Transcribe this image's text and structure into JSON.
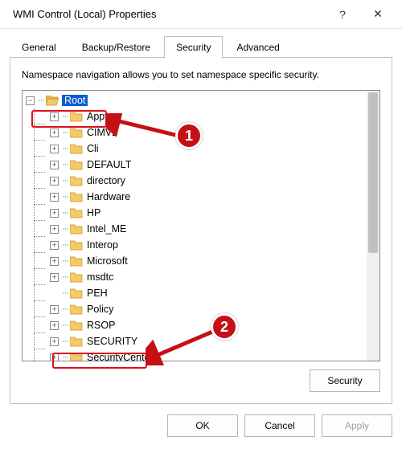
{
  "window": {
    "title": "WMI Control (Local) Properties",
    "help_symbol": "?",
    "close_symbol": "✕"
  },
  "tabs": {
    "items": [
      {
        "label": "General"
      },
      {
        "label": "Backup/Restore"
      },
      {
        "label": "Security",
        "active": true
      },
      {
        "label": "Advanced"
      }
    ]
  },
  "panel": {
    "description": "Namespace navigation allows you to set namespace specific security."
  },
  "tree": {
    "root": {
      "label": "Root",
      "expanded": true,
      "selected": true
    },
    "children": [
      {
        "label": "Appv",
        "expandable": true
      },
      {
        "label": "CIMV2",
        "expandable": true
      },
      {
        "label": "Cli",
        "expandable": true
      },
      {
        "label": "DEFAULT",
        "expandable": true
      },
      {
        "label": "directory",
        "expandable": true
      },
      {
        "label": "Hardware",
        "expandable": true
      },
      {
        "label": "HP",
        "expandable": true
      },
      {
        "label": "Intel_ME",
        "expandable": true
      },
      {
        "label": "Interop",
        "expandable": true
      },
      {
        "label": "Microsoft",
        "expandable": true
      },
      {
        "label": "msdtc",
        "expandable": true
      },
      {
        "label": "PEH",
        "expandable": false
      },
      {
        "label": "Policy",
        "expandable": true
      },
      {
        "label": "RSOP",
        "expandable": true
      },
      {
        "label": "SECURITY",
        "expandable": true,
        "highlighted": true
      },
      {
        "label": "SecurityCenter",
        "expandable": true
      }
    ]
  },
  "buttons": {
    "security": "Security",
    "ok": "OK",
    "cancel": "Cancel",
    "apply": "Apply"
  },
  "annotations": {
    "callout1": "1",
    "callout2": "2"
  }
}
